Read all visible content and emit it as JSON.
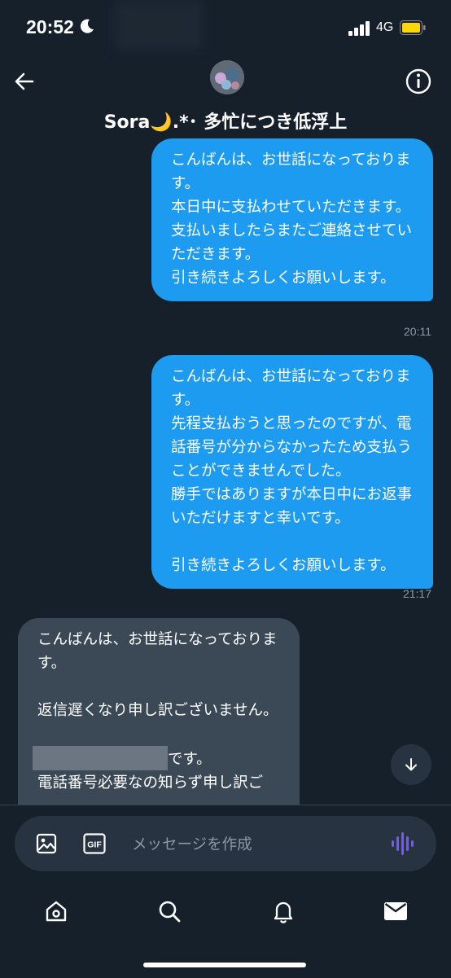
{
  "status_bar": {
    "time": "20:52",
    "network": "4G"
  },
  "header": {
    "title": "Sora🌙.*･ 多忙につき低浮上"
  },
  "messages": [
    {
      "direction": "sent",
      "text": "こんばんは、お世話になっております。\n本日中に支払わせていただきます。\n支払いましたらまたご連絡させていただきます。\n引き続きよろしくお願いします。",
      "time": "20:11"
    },
    {
      "direction": "sent",
      "text": "こんばんは、お世話になっております。\n先程支払おうと思ったのですが、電話番号が分からなかったため支払うことができませんでした。\n勝手ではありますが本日中にお返事いただけますと幸いです。\n\n引き続きよろしくお願いします。",
      "time": "21:17"
    },
    {
      "direction": "received",
      "text_before": "こんばんは、お世話になっております。\n\n返信遅くなり申し訳ございません。\n\n",
      "text_after": "です。\n電話番号必要なの知らず申し訳ご"
    }
  ],
  "composer": {
    "placeholder": "メッセージを作成"
  },
  "icons": {
    "back": "back-arrow-icon",
    "info": "info-icon",
    "scroll_down": "arrow-down-icon",
    "image": "image-icon",
    "gif": "gif-icon",
    "voice": "voice-icon",
    "home": "home-icon",
    "search": "search-icon",
    "notifications": "bell-icon",
    "messages": "mail-icon"
  },
  "colors": {
    "background": "#15202b",
    "sent_bubble": "#1d9bf0",
    "received_bubble": "#3b4856",
    "accent": "#1d9bf0",
    "voice": "#7856ff"
  }
}
